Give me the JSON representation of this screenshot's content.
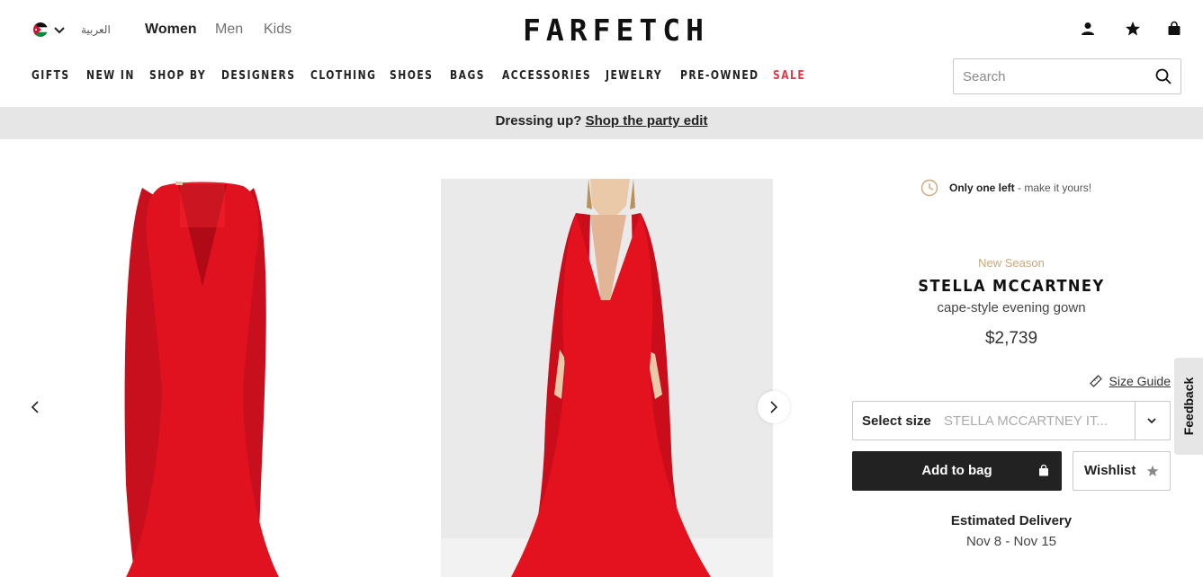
{
  "header": {
    "language_label": "العربية",
    "genders": [
      {
        "label": "Women",
        "active": true
      },
      {
        "label": "Men",
        "active": false
      },
      {
        "label": "Kids",
        "active": false
      }
    ],
    "logo": "FARFETCH",
    "icons": [
      "user-icon",
      "star-icon",
      "bag-icon"
    ]
  },
  "nav": {
    "items": [
      "GIFTS",
      "NEW IN",
      "SHOP BY",
      "DESIGNERS",
      "CLOTHING",
      "SHOES",
      "BAGS",
      "ACCESSORIES",
      "JEWELRY",
      "PRE-OWNED",
      "SALE"
    ],
    "sale_color": "#e63946",
    "search_placeholder": "Search"
  },
  "banner": {
    "text": "Dressing up?",
    "link": "Shop the party edit"
  },
  "product": {
    "stock_bold": "Only one left",
    "stock_rest": " - make it yours!",
    "season": "New Season",
    "brand": "STELLA MCCARTNEY",
    "description": "cape-style evening gown",
    "price": "$2,739",
    "size_guide": "Size Guide",
    "size_label": "Select size",
    "size_value": "STELLA MCCARTNEY IT...",
    "add_to_bag": "Add to bag",
    "wishlist": "Wishlist",
    "delivery_title": "Estimated Delivery",
    "delivery_dates": "Nov 8 - Nov 15",
    "dress_color": "#e0121f"
  },
  "feedback": "Feedback"
}
